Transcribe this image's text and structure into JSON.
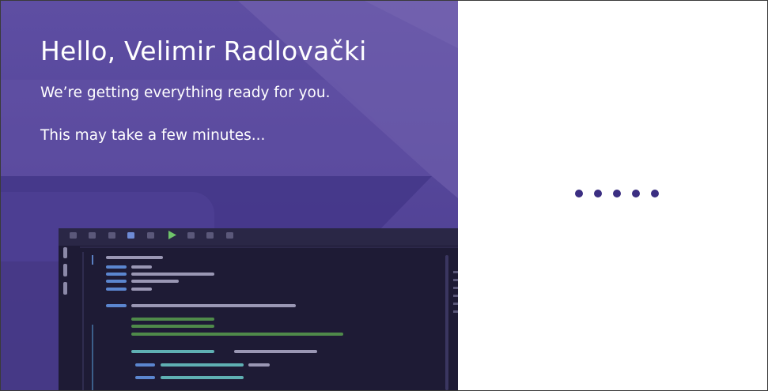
{
  "welcome": {
    "greeting": "Hello, Velimir Radlovački",
    "subtitle": "We’re getting everything ready for you.",
    "note": "This may take a few minutes..."
  },
  "loading": {
    "indicator": "loading-dots",
    "dot_count": 5
  },
  "colors": {
    "hero_purple": "#5b4a9e",
    "hero_dark": "#3e3283",
    "editor_bg": "#1d1a33",
    "dot": "#3b2e82"
  }
}
